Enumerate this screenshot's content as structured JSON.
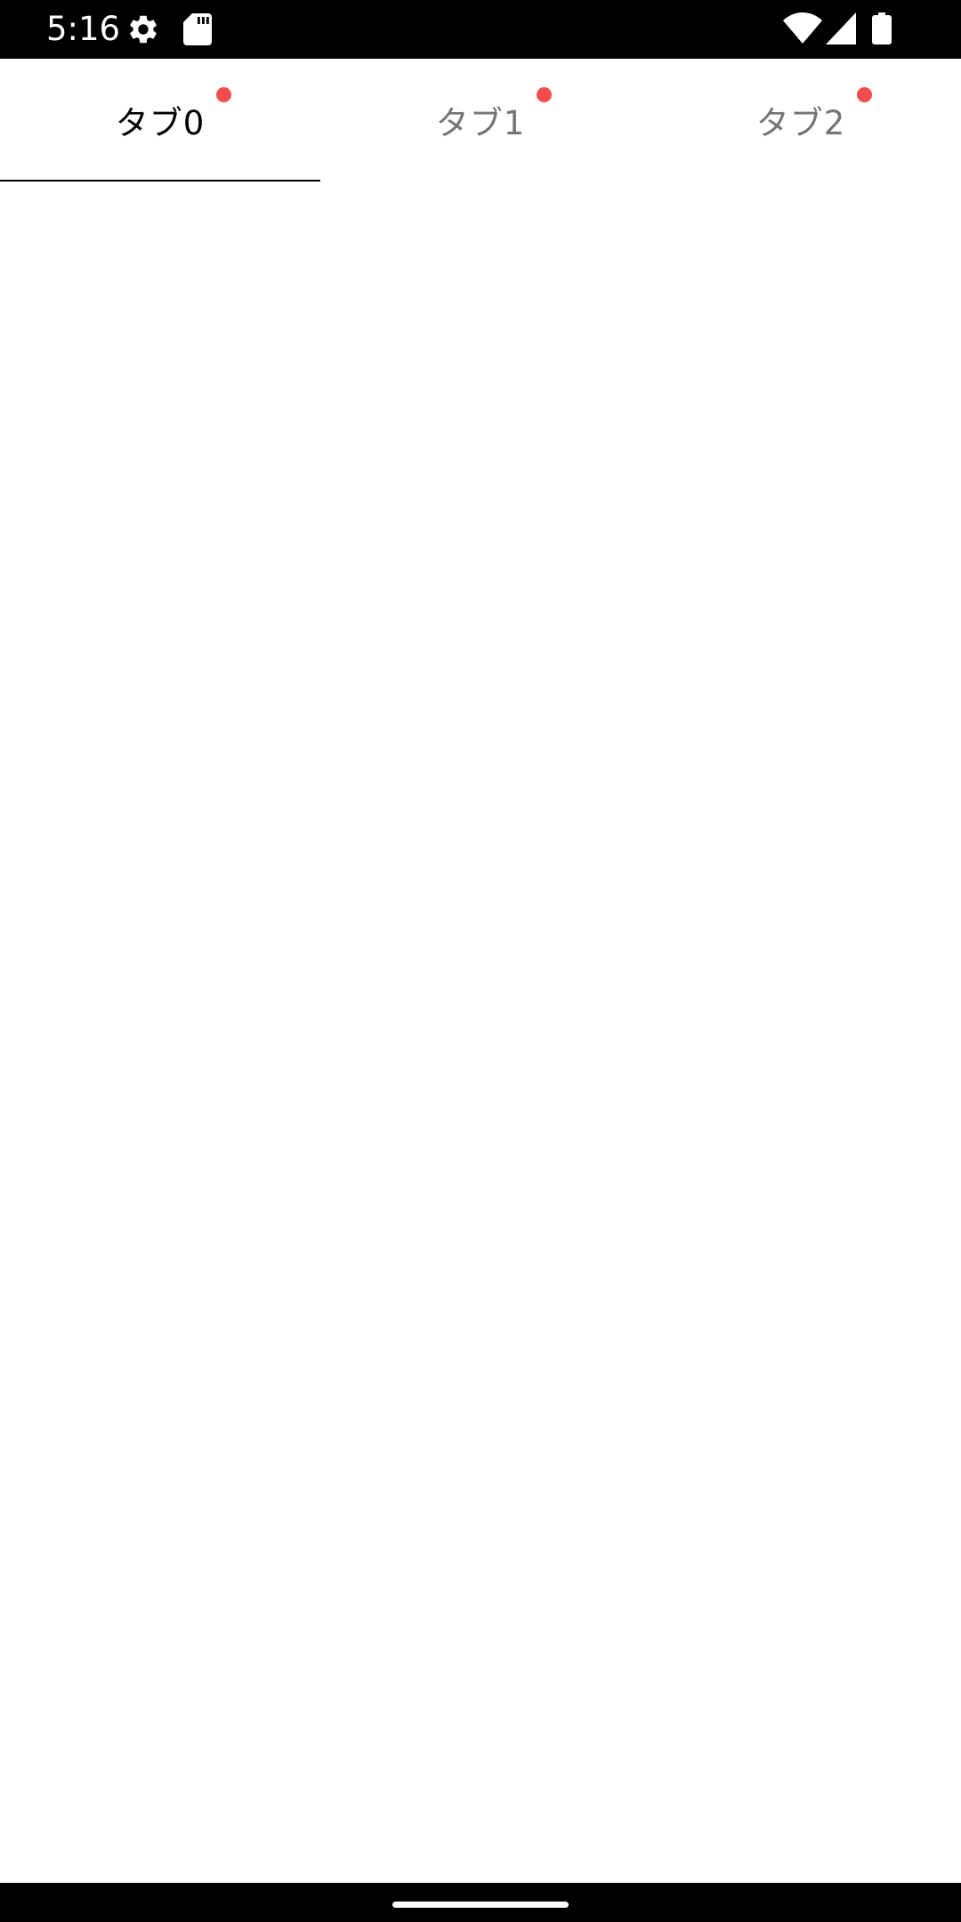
{
  "status_bar": {
    "time": "5:16",
    "left_icons": [
      "gear-icon",
      "sd-card-icon"
    ],
    "right_icons": [
      "wifi-icon",
      "cell-signal-icon",
      "battery-icon"
    ]
  },
  "tabs": [
    {
      "label": "タブ0",
      "active": true,
      "badge": true
    },
    {
      "label": "タブ1",
      "active": false,
      "badge": true
    },
    {
      "label": "タブ2",
      "active": false,
      "badge": true
    }
  ],
  "colors": {
    "badge": "#f44c4c",
    "active_text": "#000000",
    "inactive_text": "#757575",
    "indicator": "#000000",
    "background": "#ffffff"
  }
}
